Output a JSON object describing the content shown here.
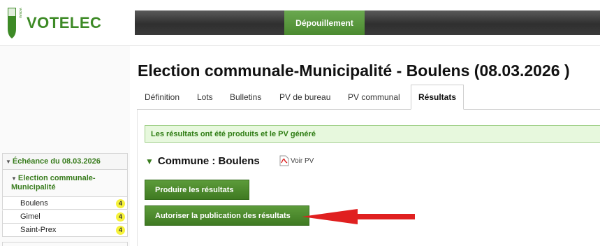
{
  "header": {
    "brand": "VOTELEC",
    "seal_text": "canton de vaud",
    "nav_active": "Dépouillement"
  },
  "sidebar": {
    "echeance": "Échéance du 08.03.2026",
    "election": "Election communale-Municipalité",
    "communes": [
      {
        "name": "Boulens",
        "count": "4"
      },
      {
        "name": "Gimel",
        "count": "4"
      },
      {
        "name": "Saint-Prex",
        "count": "4"
      }
    ]
  },
  "main": {
    "title": "Election communale-Municipalité - Boulens (08.03.2026 )",
    "tabs": [
      {
        "label": "Définition"
      },
      {
        "label": "Lots"
      },
      {
        "label": "Bulletins"
      },
      {
        "label": "PV de bureau"
      },
      {
        "label": "PV communal"
      },
      {
        "label": "Résultats"
      }
    ],
    "success_message": "Les résultats ont été produits et le PV généré",
    "commune_heading": "Commune : Boulens",
    "voir_pv": "Voir PV",
    "btn_produce": "Produire les résultats",
    "btn_publish": "Autoriser la publication des résultats"
  },
  "colors": {
    "brand_green": "#3d8a26",
    "annotation_red": "#e02020",
    "badge_yellow": "#f6f23a"
  }
}
